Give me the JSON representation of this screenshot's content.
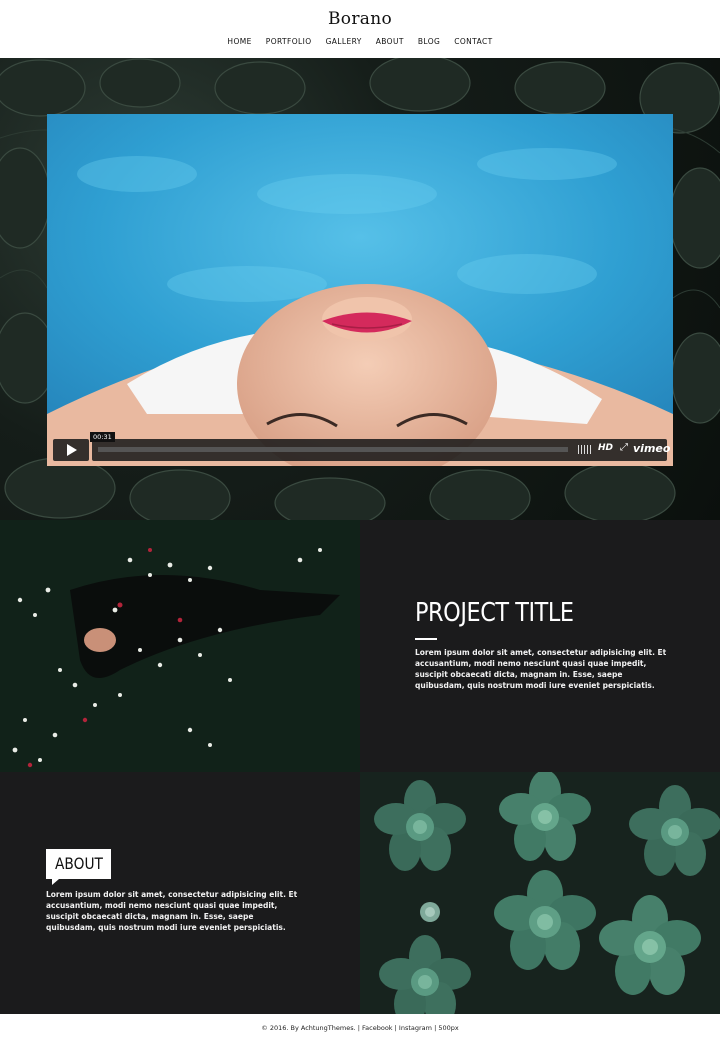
{
  "header": {
    "logo": "Borano",
    "nav": [
      "HOME",
      "PORTFOLIO",
      "GALLERY",
      "ABOUT",
      "BLOG",
      "CONTACT"
    ]
  },
  "video": {
    "timecode": "00:31",
    "hd_label": "HD",
    "brand": "vimeo",
    "progress": 0
  },
  "project": {
    "title": "PROJECT TITLE",
    "body": "Lorem ipsum dolor sit amet, consectetur adipisicing elit. Et accusantium, modi nemo nesciunt quasi quae impedit, suscipit obcaecati dicta, magnam in. Esse, saepe quibusdam, quis nostrum modi iure eveniet perspiciatis."
  },
  "about": {
    "label": "ABOUT",
    "body": "Lorem ipsum dolor sit amet, consectetur adipisicing elit. Et accusantium, modi nemo nesciunt quasi quae impedit, suscipit obcaecati dicta, magnam in. Esse, saepe quibusdam, quis nostrum modi iure eveniet perspiciatis."
  },
  "footer": {
    "prefix": "© 2016. By AchtungThemes.",
    "links": [
      "Facebook",
      "Instagram",
      "500px"
    ]
  },
  "colors": {
    "dark_panel": "#1b1b1c",
    "pool_blue": "#3aa7d6",
    "succulent_green": "#4a8a73"
  }
}
